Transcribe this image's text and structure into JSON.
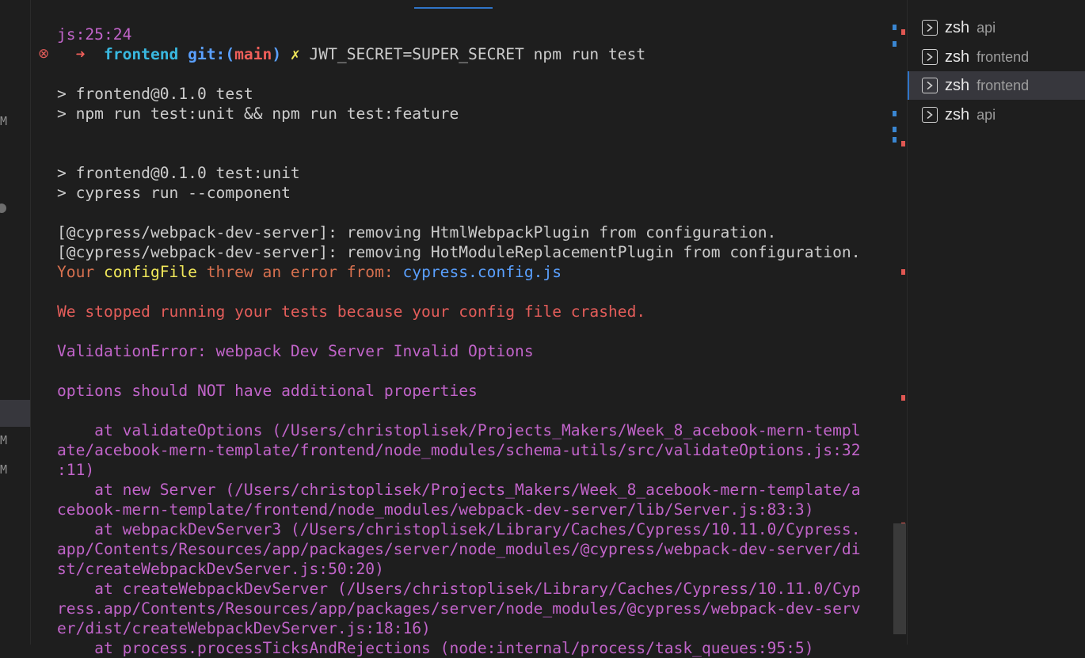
{
  "gutter": {
    "modified_marker": "M"
  },
  "terminal_lines": [
    [
      {
        "t": "js:25:24",
        "c": "c-purple"
      }
    ],
    [
      {
        "t": "  ",
        "c": "c-fg"
      },
      {
        "t": "➜  ",
        "c": "c-bold-red"
      },
      {
        "t": "frontend ",
        "c": "c-bold-cyan"
      },
      {
        "t": "git:(",
        "c": "c-bold-blue"
      },
      {
        "t": "main",
        "c": "c-bold-red"
      },
      {
        "t": ") ",
        "c": "c-bold-blue"
      },
      {
        "t": "✗ ",
        "c": "c-bold-yellow"
      },
      {
        "t": "JWT_SECRET=SUPER_SECRET npm run test",
        "c": "c-fg"
      }
    ],
    [],
    [
      {
        "t": "> frontend@0.1.0 test",
        "c": "c-fg"
      }
    ],
    [
      {
        "t": "> npm run test:unit && npm run test:feature",
        "c": "c-fg"
      }
    ],
    [],
    [],
    [
      {
        "t": "> frontend@0.1.0 test:unit",
        "c": "c-fg"
      }
    ],
    [
      {
        "t": "> cypress run --component",
        "c": "c-fg"
      }
    ],
    [],
    [
      {
        "t": "[@cypress/webpack-dev-server]: removing HtmlWebpackPlugin from configuration.",
        "c": "c-fg"
      }
    ],
    [
      {
        "t": "[@cypress/webpack-dev-server]: removing HotModuleReplacementPlugin from configuration.",
        "c": "c-fg"
      }
    ],
    [
      {
        "t": "Your ",
        "c": "c-orange"
      },
      {
        "t": "configFile",
        "c": "c-yellow"
      },
      {
        "t": " threw an error from: ",
        "c": "c-orange"
      },
      {
        "t": "cypress.config.js",
        "c": "c-blue"
      }
    ],
    [],
    [
      {
        "t": "We stopped running your tests because your config file crashed.",
        "c": "c-red"
      }
    ],
    [],
    [
      {
        "t": "ValidationError: webpack Dev Server Invalid Options",
        "c": "c-purple"
      }
    ],
    [],
    [
      {
        "t": "options should NOT have additional properties",
        "c": "c-purple"
      }
    ],
    [],
    [
      {
        "t": "    at validateOptions (/Users/christoplisek/Projects_Makers/Week_8_acebook-mern-templ",
        "c": "c-purple"
      }
    ],
    [
      {
        "t": "ate/acebook-mern-template/frontend/node_modules/schema-utils/src/validateOptions.js:32",
        "c": "c-purple"
      }
    ],
    [
      {
        "t": ":11)",
        "c": "c-purple"
      }
    ],
    [
      {
        "t": "    at new Server (/Users/christoplisek/Projects_Makers/Week_8_acebook-mern-template/a",
        "c": "c-purple"
      }
    ],
    [
      {
        "t": "cebook-mern-template/frontend/node_modules/webpack-dev-server/lib/Server.js:83:3)",
        "c": "c-purple"
      }
    ],
    [
      {
        "t": "    at webpackDevServer3 (/Users/christoplisek/Library/Caches/Cypress/10.11.0/Cypress.",
        "c": "c-purple"
      }
    ],
    [
      {
        "t": "app/Contents/Resources/app/packages/server/node_modules/@cypress/webpack-dev-server/di",
        "c": "c-purple"
      }
    ],
    [
      {
        "t": "st/createWebpackDevServer.js:50:20)",
        "c": "c-purple"
      }
    ],
    [
      {
        "t": "    at createWebpackDevServer (/Users/christoplisek/Library/Caches/Cypress/10.11.0/Cyp",
        "c": "c-purple"
      }
    ],
    [
      {
        "t": "ress.app/Contents/Resources/app/packages/server/node_modules/@cypress/webpack-dev-serv",
        "c": "c-purple"
      }
    ],
    [
      {
        "t": "er/dist/createWebpackDevServer.js:18:16)",
        "c": "c-purple"
      }
    ],
    [
      {
        "t": "    at process.processTicksAndRejections (node:internal/process/task_queues:95:5)",
        "c": "c-purple"
      }
    ]
  ],
  "error_glyph": "⊗",
  "terminals": [
    {
      "name": "zsh",
      "desc": "api",
      "active": false
    },
    {
      "name": "zsh",
      "desc": "frontend",
      "active": false
    },
    {
      "name": "zsh",
      "desc": "frontend",
      "active": true
    },
    {
      "name": "zsh",
      "desc": "api",
      "active": false
    }
  ],
  "colors": {
    "accent": "#2f74c8",
    "error": "#e45d5a",
    "stack": "#c164c9"
  }
}
